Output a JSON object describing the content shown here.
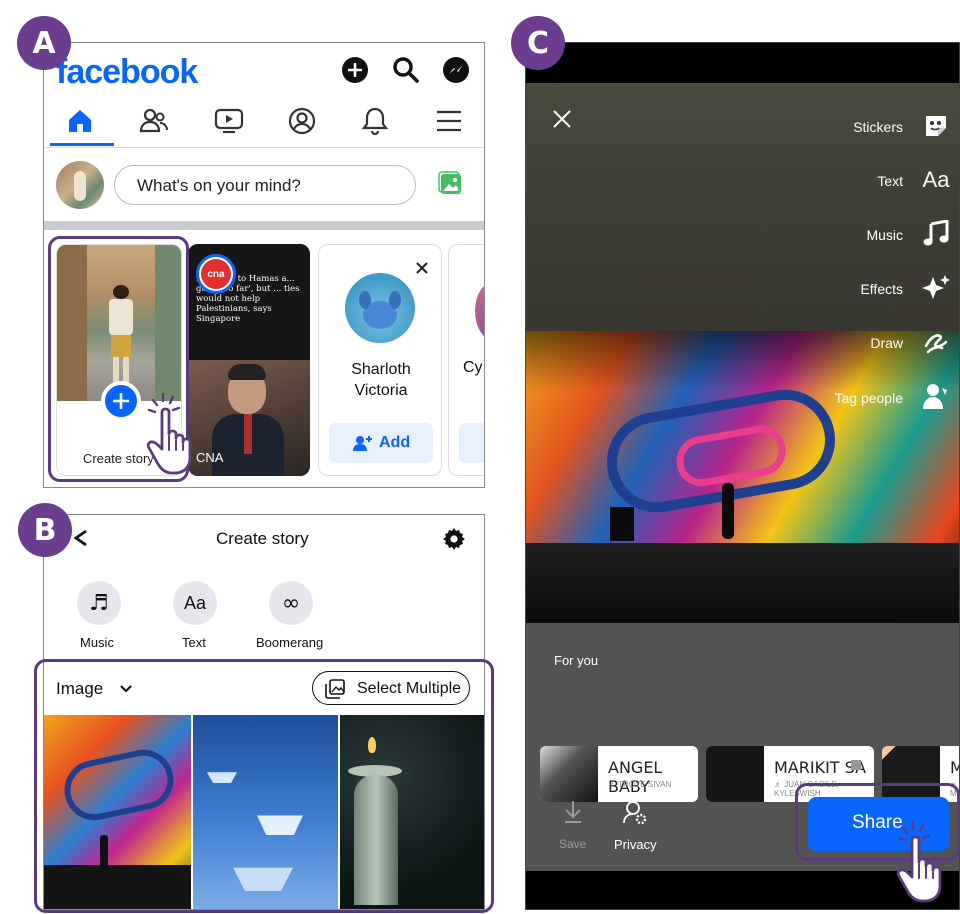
{
  "badges": {
    "a": "A",
    "b": "B",
    "c": "C"
  },
  "panelA": {
    "logo": "facebook",
    "composer_placeholder": "What's on your mind?",
    "stories": {
      "create_label": "Create story",
      "news_headline": "response to Hamas a... gone too far', but ... ties would not help Palestinians, says Singapore",
      "news_source_logo": "cna",
      "news_source": "CNA",
      "friend_name": "Sharloth Victoria",
      "add_label": "Add",
      "next_name": "Cy"
    }
  },
  "panelB": {
    "title": "Create story",
    "modes": [
      "Music",
      "Text",
      "Boomerang"
    ],
    "mode_glyphs": {
      "music": "♬",
      "text": "Aa",
      "boomerang": "∞"
    },
    "gallery_filter": "Image",
    "select_multiple": "Select Multiple"
  },
  "panelC": {
    "tools": [
      "Stickers",
      "Text",
      "Music",
      "Effects",
      "Draw",
      "Tag people"
    ],
    "text_glyph": "Aa",
    "for_you": "For you",
    "songs": [
      {
        "title": "ANGEL BABY",
        "artist": "♬ TROYE SIVAN"
      },
      {
        "title": "MARIKIT SA",
        "artist": "♬ JUAN CAOILE, KYLESWISH"
      },
      {
        "title": "M",
        "artist": "♬ M"
      }
    ],
    "save": "Save",
    "privacy": "Privacy",
    "share": "Share"
  },
  "colors": {
    "accent": "#0866ff",
    "badge": "#6a3d8f",
    "highlight": "#5b3a7e",
    "logo_blue": "#0866ff"
  }
}
